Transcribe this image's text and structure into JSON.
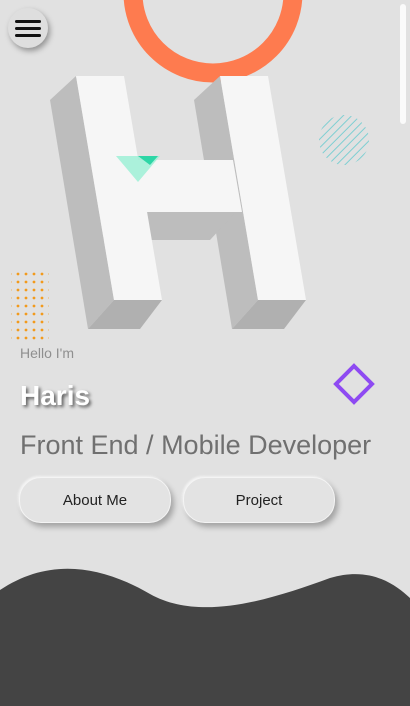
{
  "nav": {
    "menu_icon": "hamburger-icon"
  },
  "hero": {
    "logo_letter": "H",
    "greeting": "Hello I'm",
    "name": "Haris",
    "role": "Front End / Mobile Developer"
  },
  "buttons": {
    "about_label": "About Me",
    "project_label": "Project"
  },
  "colors": {
    "background": "#e1e1e1",
    "ring": "#fe7b4f",
    "stripes": "#7fcfd2",
    "dots": "#f29a1c",
    "diamond": "#8e4af2",
    "triangle": "#2dd6a6",
    "wave": "#444444"
  }
}
